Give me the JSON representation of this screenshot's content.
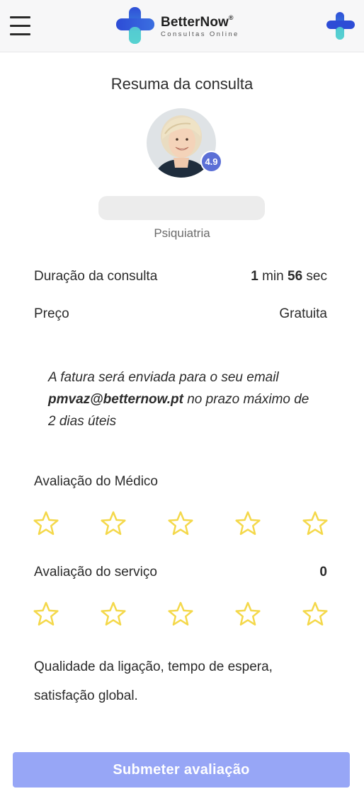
{
  "header": {
    "menu_icon": "hamburger-menu-icon",
    "brand_name": "BetterNow",
    "brand_reg": "®",
    "brand_tagline": "Consultas Online",
    "right_icon": "cross-logo-icon",
    "brand_colors": {
      "primary": "#2f4fd8",
      "secondary": "#5ad6d2"
    }
  },
  "summary": {
    "title": "Resuma da consulta",
    "rating_badge": "4.9",
    "specialty": "Psiquiatria"
  },
  "details": {
    "duration_label": "Duração da consulta",
    "duration_minutes": "1",
    "duration_min_unit": "min",
    "duration_seconds": "56",
    "duration_sec_unit": "sec",
    "price_label": "Preço",
    "price_value": "Gratuita"
  },
  "invoice": {
    "text_before": "A fatura será enviada para o seu email",
    "email": "pmvaz@betternow.pt",
    "text_after": "no prazo máximo de 2 dias úteis"
  },
  "doctor_rating": {
    "label": "Avaliação do Médico",
    "stars_total": 5,
    "stars_selected": 0
  },
  "service_rating": {
    "label": "Avaliação do serviço",
    "count": "0",
    "stars_total": 5,
    "stars_selected": 0
  },
  "quality_note": "Qualidade da ligação, tempo de espera, satisfação global.",
  "submit_label": "Submeter avaliação",
  "colors": {
    "accent": "#5b6fd6",
    "button": "#97a6f6",
    "star_outline": "#f4d84a"
  }
}
